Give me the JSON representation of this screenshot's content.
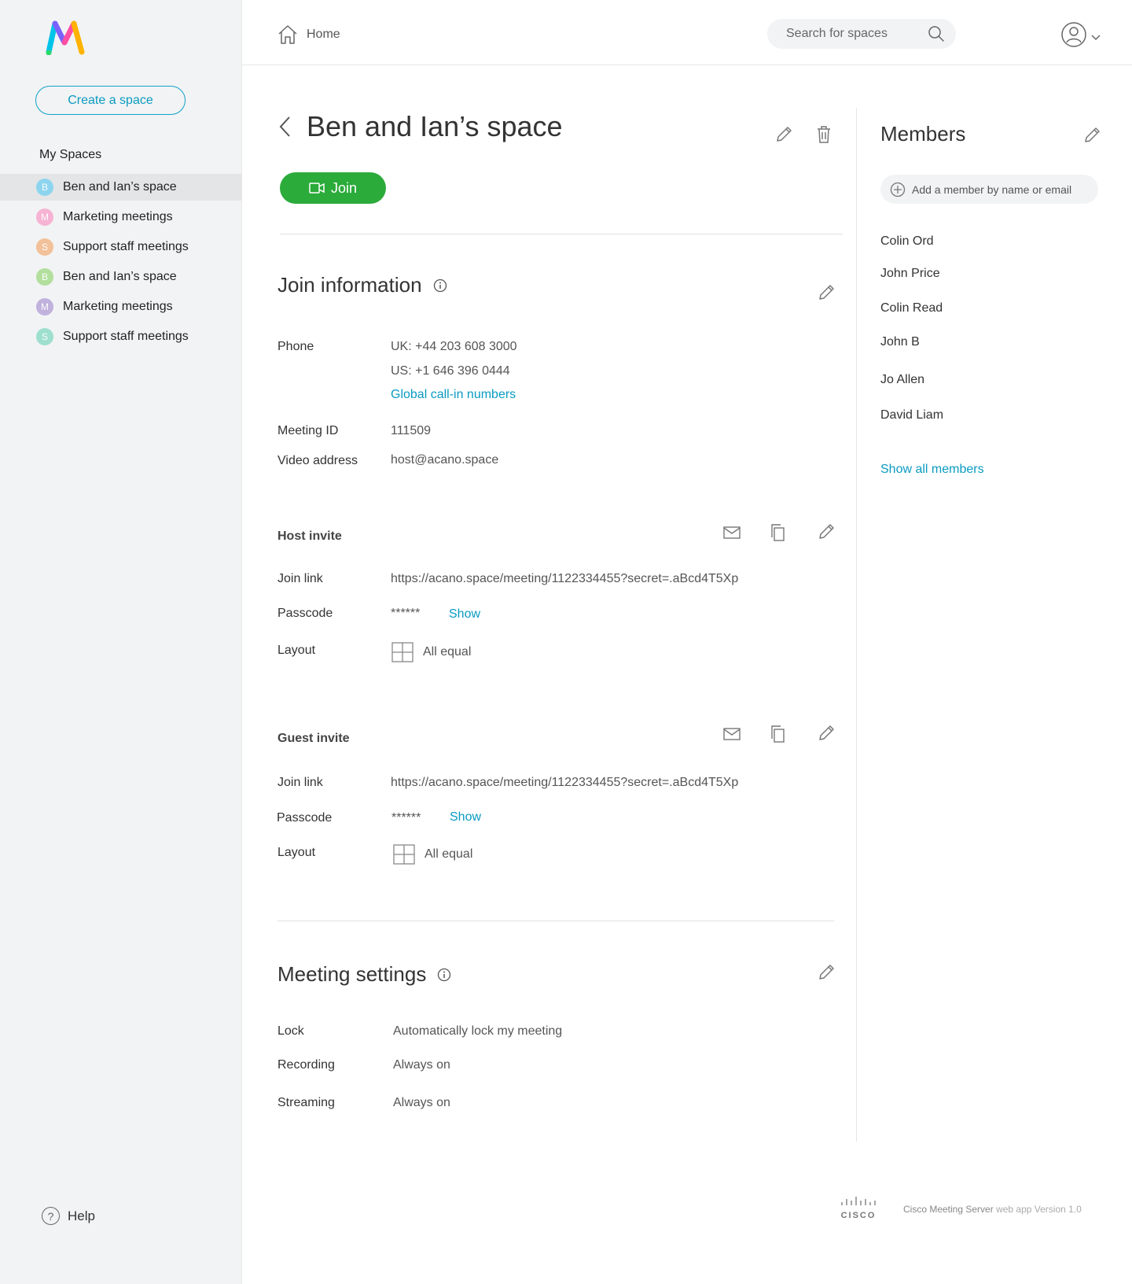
{
  "sidebar": {
    "create_label": "Create a space",
    "title": "My Spaces",
    "spaces": [
      {
        "label": "Ben and Ian’s space",
        "initial": "B",
        "color": "#7fd3f0",
        "active": true
      },
      {
        "label": "Marketing meetings",
        "initial": "M",
        "color": "#f7a8cf",
        "active": false
      },
      {
        "label": "Support staff meetings",
        "initial": "S",
        "color": "#f2b98a",
        "active": false
      },
      {
        "label": "Ben and Ian’s space",
        "initial": "B",
        "color": "#a8dc8e",
        "active": false
      },
      {
        "label": "Marketing meetings",
        "initial": "M",
        "color": "#b8a6d9",
        "active": false
      },
      {
        "label": "Support staff meetings",
        "initial": "S",
        "color": "#90dcc8",
        "active": false
      }
    ],
    "help_label": "Help"
  },
  "topbar": {
    "home_label": "Home",
    "search_placeholder": "Search for spaces"
  },
  "space": {
    "title": "Ben and Ian’s space",
    "join_label": "Join"
  },
  "join_info": {
    "title": "Join information",
    "phone_label": "Phone",
    "phone_uk": "UK: +44 203 608 3000",
    "phone_us": "US: +1 646 396 0444",
    "global_link": "Global call-in numbers",
    "meeting_id_label": "Meeting ID",
    "meeting_id": "111509",
    "video_label": "Video address",
    "video_address": "host@acano.space"
  },
  "host_invite": {
    "title": "Host invite",
    "join_link_label": "Join link",
    "join_link": "https://acano.space/meeting/1122334455?secret=.aBcd4T5Xp",
    "passcode_label": "Passcode",
    "passcode": "******",
    "show_label": "Show",
    "layout_label": "Layout",
    "layout": "All equal"
  },
  "guest_invite": {
    "title": "Guest invite",
    "join_link_label": "Join link",
    "join_link": "https://acano.space/meeting/1122334455?secret=.aBcd4T5Xp",
    "passcode_label": "Passcode",
    "passcode": "******",
    "show_label": "Show",
    "layout_label": "Layout",
    "layout": "All equal"
  },
  "meeting_settings": {
    "title": "Meeting settings",
    "lock_label": "Lock",
    "lock_value": "Automatically lock my meeting",
    "recording_label": "Recording",
    "recording_value": "Always on",
    "streaming_label": "Streaming",
    "streaming_value": "Always on"
  },
  "members": {
    "title": "Members",
    "add_placeholder": "Add a member by name or email",
    "list": [
      "Colin Ord",
      "John Price",
      "Colin Read",
      "John B",
      "Jo Allen",
      "David Liam"
    ],
    "show_all": "Show all members"
  },
  "footer": {
    "brand": "CISCO",
    "product": "Cisco Meeting Server",
    "version": "web app Version 1.0"
  },
  "colors": {
    "accent": "#0a9bc1",
    "join_green": "#2bab3a",
    "sidebar_bg": "#f2f3f4"
  }
}
